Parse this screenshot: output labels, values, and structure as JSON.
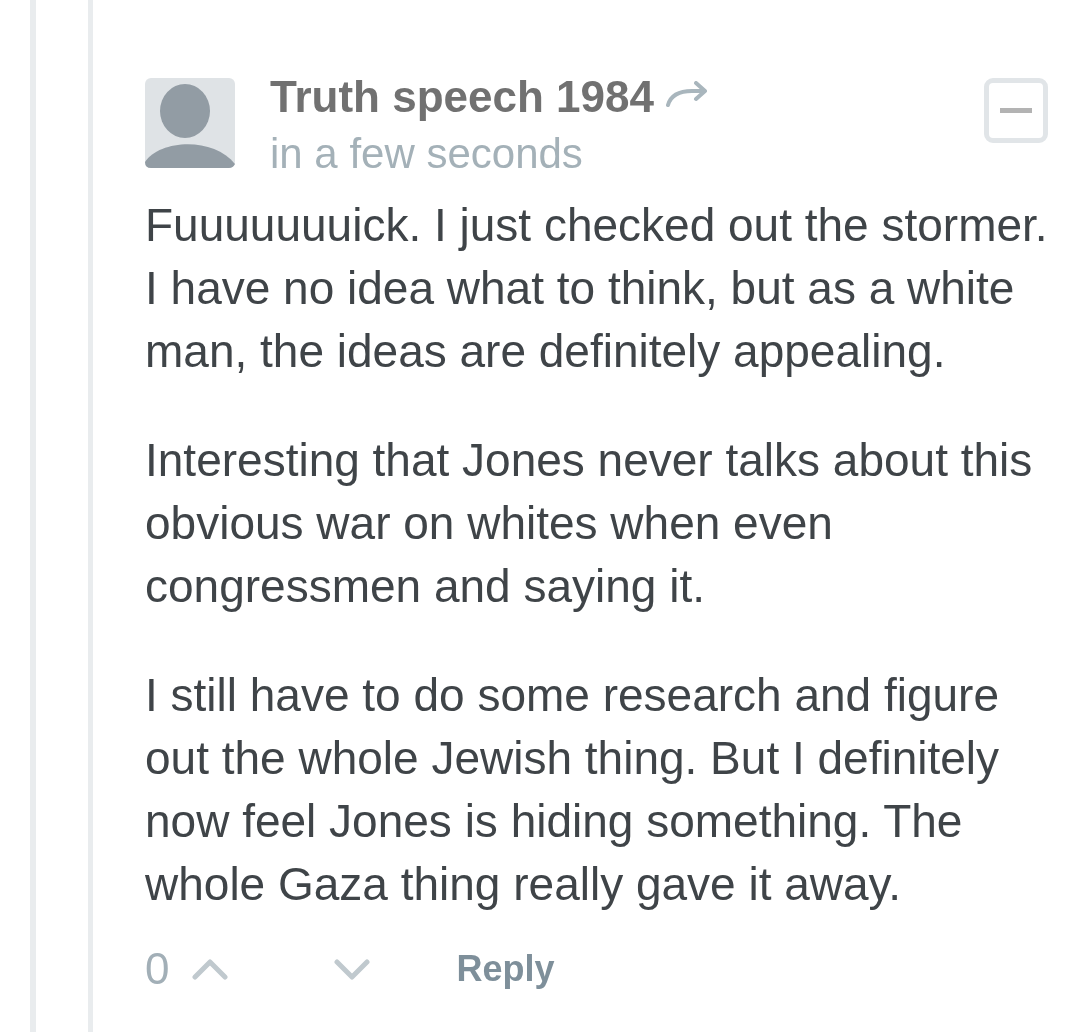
{
  "comment": {
    "author": "Truth speech 1984",
    "timestamp": "in a few seconds",
    "paragraphs": [
      "Fuuuuuuuick. I just checked out the stormer. I have no idea what to think, but as a white man, the ideas are definitely appealing.",
      "Interesting that Jones never talks about this obvious war on whites when even congressmen and saying it.",
      "I still have to do some research and figure out the whole Jewish thing. But I definitely now feel Jones is hiding something. The whole Gaza thing really gave it away."
    ],
    "vote_count": "0",
    "reply_label": "Reply"
  }
}
